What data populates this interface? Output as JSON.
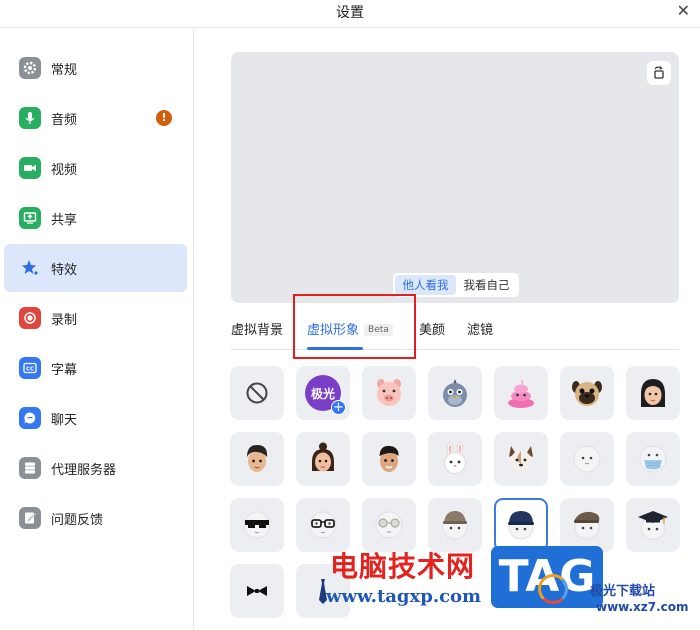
{
  "window": {
    "title": "设置",
    "close_icon": "close-icon"
  },
  "sidebar": {
    "items": [
      {
        "label": "常规",
        "icon": "gear-icon",
        "color": "#8b8f96"
      },
      {
        "label": "音频",
        "icon": "microphone-icon",
        "color": "#27ae60",
        "badge": "!"
      },
      {
        "label": "视频",
        "icon": "video-camera-icon",
        "color": "#27ae60"
      },
      {
        "label": "共享",
        "icon": "share-screen-icon",
        "color": "#27ae60"
      },
      {
        "label": "特效",
        "icon": "effects-star-icon",
        "color": "#2d6fe0",
        "active": true
      },
      {
        "label": "录制",
        "icon": "record-icon",
        "color": "#e2463a"
      },
      {
        "label": "字幕",
        "icon": "captions-icon",
        "color": "#3478f6"
      },
      {
        "label": "聊天",
        "icon": "chat-icon",
        "color": "#3478f6"
      },
      {
        "label": "代理服务器",
        "icon": "proxy-server-icon",
        "color": "#8b8f96"
      },
      {
        "label": "问题反馈",
        "icon": "feedback-icon",
        "color": "#8b8f96"
      }
    ]
  },
  "preview": {
    "toggle": [
      "他人看我",
      "我看自己"
    ],
    "selected_view": "他人看我",
    "rotate_icon": "rotate-camera-icon"
  },
  "tabs": {
    "items": [
      "虚拟背景",
      "虚拟形象",
      "美颜",
      "滤镜"
    ],
    "active": "虚拟形象",
    "beta_label": "Beta"
  },
  "avatars": {
    "aurora_label": "极光",
    "items": [
      "none",
      "aurora-add",
      "pig",
      "bird",
      "poop",
      "pug",
      "girl-long-hair",
      "boy-1",
      "girl-buns",
      "boy-2",
      "bunny",
      "dog",
      "blank-face",
      "face-mask",
      "sunglasses",
      "glasses",
      "round-glasses",
      "cap",
      "helmet",
      "flat-cap",
      "grad-cap",
      "bow-tie",
      "tie"
    ],
    "selected_index": 18
  },
  "watermark": {
    "cn_text": "电脑技术网",
    "url": "www.tagxp.com",
    "tag": "TAG",
    "site_cn": "极光下载站",
    "site_url": "www.xz7.com"
  }
}
